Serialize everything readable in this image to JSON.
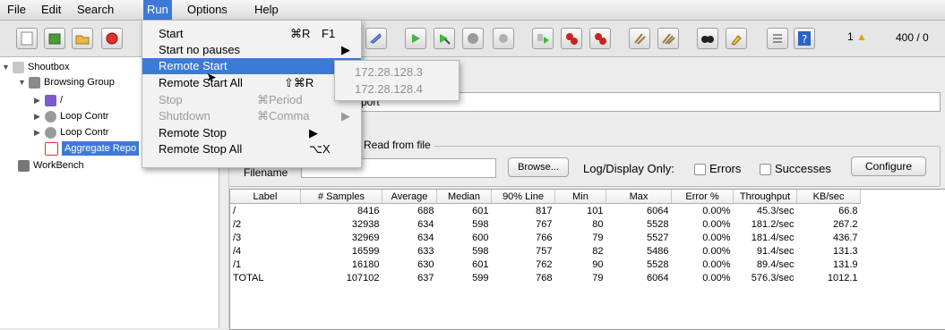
{
  "menubar": [
    "File",
    "Edit",
    "Search",
    "Run",
    "Options",
    "Help"
  ],
  "toolbar": {
    "icons": [
      "new-icon",
      "templates-icon",
      "open-icon",
      "save-icon",
      "cut-icon",
      "expand-icon",
      "start-icon",
      "start-no-pause-icon",
      "stop-icon",
      "shutdown-icon",
      "remote-start-icon",
      "remote-stop-icon",
      "remote-shutdown-icon",
      "clear-icon",
      "clear-all-icon",
      "search-icon",
      "reset-search-icon",
      "function-helper-icon",
      "help-icon"
    ],
    "warning_count": "1",
    "threads": "400 / 0"
  },
  "tree": {
    "nodes": [
      {
        "label": "Shoutbox"
      },
      {
        "label": "Browsing Group"
      },
      {
        "label": "/"
      },
      {
        "label": "Loop Contr"
      },
      {
        "label": "Loop Contr"
      },
      {
        "label": "Aggregate Repo"
      },
      {
        "label": "WorkBench"
      }
    ]
  },
  "panel": {
    "name_fragment": "port",
    "write_label": "Read from file",
    "filename_label": "Filename",
    "browse": "Browse...",
    "log_display": "Log/Display Only:",
    "errors": "Errors",
    "successes": "Successes",
    "configure": "Configure"
  },
  "run_menu": {
    "items": [
      {
        "label": "Start",
        "shortcut": "⌘R",
        "extra": "F1",
        "state": "normal"
      },
      {
        "label": "Start no pauses",
        "shortcut": "",
        "extra": "▶",
        "state": "normal"
      },
      {
        "label": "Remote Start",
        "shortcut": "",
        "extra": "▶",
        "state": "highlighted"
      },
      {
        "label": "Remote Start All",
        "shortcut": "⇧⌘R",
        "extra": "",
        "state": "normal"
      },
      {
        "label": "Stop",
        "shortcut": "⌘Period",
        "extra": "",
        "state": "disabled"
      },
      {
        "label": "Shutdown",
        "shortcut": "⌘Comma",
        "extra": "▶",
        "state": "disabled"
      },
      {
        "label": "Remote Stop",
        "shortcut": "▶",
        "extra": "",
        "state": "normal"
      },
      {
        "label": "Remote Stop All",
        "shortcut": "⌥X",
        "extra": "",
        "state": "normal"
      }
    ],
    "remote_hosts": [
      "172.28.128.3",
      "172.28.128.4"
    ]
  },
  "table": {
    "columns": [
      "Label",
      "# Samples",
      "Average",
      "Median",
      "90% Line",
      "Min",
      "Max",
      "Error %",
      "Throughput",
      "KB/sec"
    ],
    "rows": [
      [
        "/",
        "8416",
        "688",
        "601",
        "817",
        "101",
        "6064",
        "0.00%",
        "45.3/sec",
        "66.8"
      ],
      [
        "/2",
        "32938",
        "634",
        "598",
        "767",
        "80",
        "5528",
        "0.00%",
        "181.2/sec",
        "267.2"
      ],
      [
        "/3",
        "32969",
        "634",
        "600",
        "766",
        "79",
        "5527",
        "0.00%",
        "181.4/sec",
        "436.7"
      ],
      [
        "/4",
        "16599",
        "633",
        "598",
        "757",
        "82",
        "5486",
        "0.00%",
        "91.4/sec",
        "131.3"
      ],
      [
        "/1",
        "16180",
        "630",
        "601",
        "762",
        "90",
        "5528",
        "0.00%",
        "89.4/sec",
        "131.9"
      ],
      [
        "TOTAL",
        "107102",
        "637",
        "599",
        "768",
        "79",
        "6064",
        "0.00%",
        "576.3/sec",
        "1012.1"
      ]
    ]
  }
}
